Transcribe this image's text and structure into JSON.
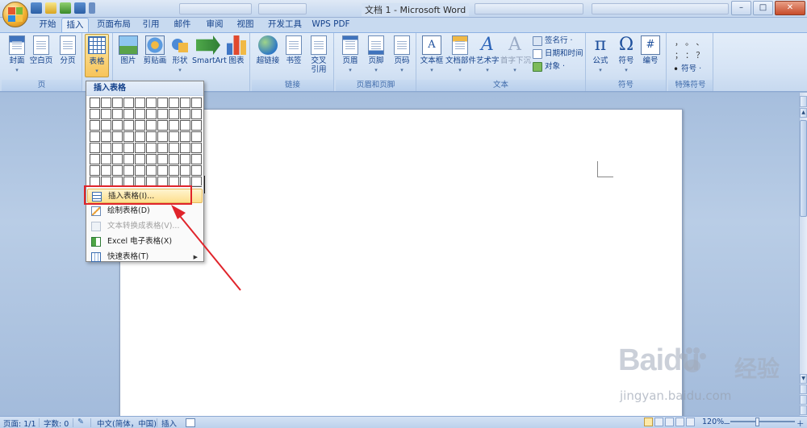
{
  "window": {
    "title": "文档 1 - Microsoft Word",
    "minimize": "–",
    "maximize": "□",
    "close": "✕"
  },
  "tabs": [
    {
      "label": "开始",
      "active": false
    },
    {
      "label": "插入",
      "active": true
    },
    {
      "label": "页面布局",
      "active": false
    },
    {
      "label": "引用",
      "active": false
    },
    {
      "label": "邮件",
      "active": false
    },
    {
      "label": "审阅",
      "active": false
    },
    {
      "label": "视图",
      "active": false
    },
    {
      "label": "开发工具",
      "active": false
    },
    {
      "label": "WPS PDF",
      "active": false
    }
  ],
  "ribbon": {
    "pages_group": {
      "label": "页",
      "cover": "封面",
      "blank": "空白页",
      "break": "分页"
    },
    "table_group": {
      "table": "表格"
    },
    "illustrations_group": {
      "picture": "图片",
      "clipart": "剪贴画",
      "shapes": "形状",
      "smartart": "SmartArt",
      "chart": "图表"
    },
    "links_group": {
      "label": "链接",
      "hyperlink": "超链接",
      "bookmark": "书签",
      "crossref_line1": "交叉",
      "crossref_line2": "引用"
    },
    "header_group": {
      "label": "页眉和页脚",
      "header": "页眉",
      "footer": "页脚",
      "page_number": "页码"
    },
    "text_group": {
      "label": "文本",
      "textbox": "文本框",
      "quickparts": "文档部件",
      "wordart": "艺术字",
      "dropcap": "首字下沉",
      "signature": "签名行 ·",
      "datetime": "日期和时间",
      "object": "对象 ·"
    },
    "symbols_group": {
      "label": "符号",
      "equation": "公式",
      "symbol": "符号",
      "number": "编号"
    },
    "special_group": {
      "label": "特殊符号",
      "symbol": "符号 ·",
      "punct_row1": "，  。  、",
      "punct_row2": "；  ：  ？"
    }
  },
  "dropdown": {
    "header": "插入表格",
    "grid": {
      "cols": 10,
      "rows": 8
    },
    "items": [
      {
        "label": "插入表格(I)...",
        "highlighted": true,
        "disabled": false,
        "icon": "table-icon"
      },
      {
        "label": "绘制表格(D)",
        "highlighted": false,
        "disabled": false,
        "icon": "pencil-icon"
      },
      {
        "label": "文本转换成表格(V)...",
        "highlighted": false,
        "disabled": true,
        "icon": "convert-icon"
      },
      {
        "label": "Excel 电子表格(X)",
        "highlighted": false,
        "disabled": false,
        "icon": "excel-icon"
      },
      {
        "label": "快速表格(T)",
        "highlighted": false,
        "disabled": false,
        "icon": "quick-table-icon",
        "submenu": "▶"
      }
    ]
  },
  "status": {
    "page": "页面: 1/1",
    "words": "字数: 0",
    "language": "中文(简体，中国)",
    "mode": "插入",
    "zoom": "120%",
    "zoom_minus": "－",
    "zoom_plus": "＋"
  },
  "scroll": {
    "up": "▲",
    "down": "▼"
  },
  "watermark": {
    "brand": "Baidu",
    "cn": "经验",
    "url": "jingyan.baidu.com"
  },
  "colors": {
    "accent": "#15428b",
    "highlight": "#fddf8d",
    "annotation": "#e0242b"
  }
}
